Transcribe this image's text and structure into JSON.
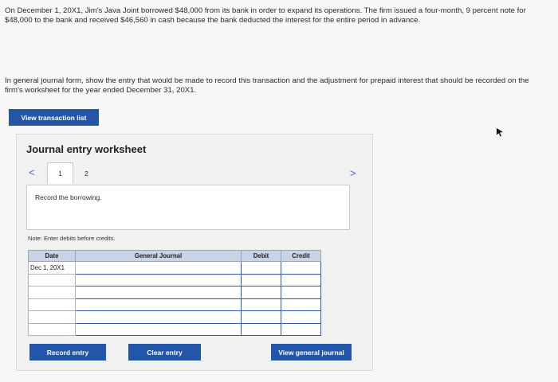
{
  "problem": {
    "text": "On December 1, 20X1, Jim's Java Joint borrowed $48,000 from its bank in order to expand its operations. The firm issued a four-month, 9 percent note for $48,000 to the bank and received $46,560 in cash because the bank deducted the interest for the entire period in advance.",
    "instructions": "In general journal form, show the entry that would be made to record this transaction and the adjustment for prepaid interest that should be recorded on the firm's worksheet for the year ended December 31, 20X1."
  },
  "buttons": {
    "view_transaction_list": "View transaction list",
    "record_entry": "Record entry",
    "clear_entry": "Clear entry",
    "view_general_journal": "View general journal"
  },
  "worksheet": {
    "title": "Journal entry worksheet",
    "prev": "<",
    "next": ">",
    "tabs": [
      "1",
      "2"
    ],
    "active_tab": "1",
    "record_text": "Record the borrowing.",
    "note": "Note: Enter debits before credits."
  },
  "journal_table": {
    "headers": [
      "Date",
      "General Journal",
      "Debit",
      "Credit"
    ],
    "rows": [
      [
        "Dec 1, 20X1",
        "",
        "",
        ""
      ],
      [
        "",
        "",
        "",
        ""
      ],
      [
        "",
        "",
        "",
        ""
      ],
      [
        "",
        "",
        "",
        ""
      ],
      [
        "",
        "",
        "",
        ""
      ],
      [
        "",
        "",
        "",
        ""
      ]
    ]
  },
  "colors": {
    "button_blue": "#2356a8",
    "table_header": "#c8d3e6",
    "nav_blue": "#3a6cc4"
  }
}
